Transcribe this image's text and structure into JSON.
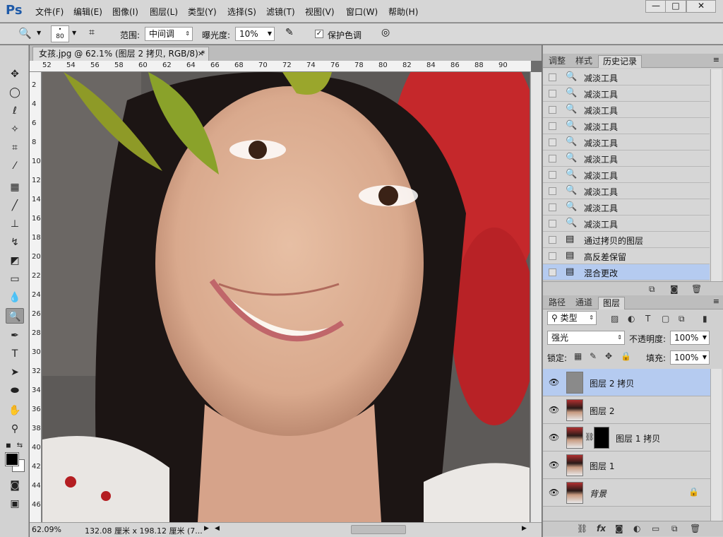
{
  "app": {
    "logo": "Ps"
  },
  "menu": [
    "文件(F)",
    "编辑(E)",
    "图像(I)",
    "图层(L)",
    "类型(Y)",
    "选择(S)",
    "滤镜(T)",
    "视图(V)",
    "窗口(W)",
    "帮助(H)"
  ],
  "window_controls": {
    "minimize": "—",
    "maximize": "□",
    "close": "✕"
  },
  "options": {
    "brush_size": "80",
    "range_label": "范围:",
    "range_value": "中间调",
    "exposure_label": "曝光度:",
    "exposure_value": "10%",
    "protect_tones_label": "保护色调",
    "protect_tones_checked": true
  },
  "document": {
    "tab_title": "女孩.jpg @ 62.1% (图层 2 拷贝, RGB/8) *",
    "close": "×",
    "ruler_h": [
      "52",
      "54",
      "56",
      "58",
      "60",
      "62",
      "64",
      "66",
      "68",
      "70",
      "72",
      "74",
      "76",
      "78",
      "80",
      "82",
      "84",
      "86",
      "88",
      "90"
    ],
    "ruler_v": [
      "2",
      "4",
      "6",
      "8",
      "10",
      "12",
      "14",
      "16",
      "18",
      "20",
      "22",
      "24",
      "26",
      "28",
      "30",
      "32",
      "34",
      "36",
      "38",
      "40",
      "42",
      "44",
      "46"
    ],
    "zoom": "62.09%",
    "doc_size": "132.08 厘米 x 198.12 厘米 (7..."
  },
  "history_panel": {
    "tabs": [
      "调整",
      "样式",
      "历史记录"
    ],
    "active_tab": "历史记录",
    "items": [
      {
        "label": "减淡工具",
        "icon": "dodge-icon"
      },
      {
        "label": "减淡工具",
        "icon": "dodge-icon"
      },
      {
        "label": "减淡工具",
        "icon": "dodge-icon"
      },
      {
        "label": "减淡工具",
        "icon": "dodge-icon"
      },
      {
        "label": "减淡工具",
        "icon": "dodge-icon"
      },
      {
        "label": "减淡工具",
        "icon": "dodge-icon"
      },
      {
        "label": "减淡工具",
        "icon": "dodge-icon"
      },
      {
        "label": "减淡工具",
        "icon": "dodge-icon"
      },
      {
        "label": "减淡工具",
        "icon": "dodge-icon"
      },
      {
        "label": "减淡工具",
        "icon": "dodge-icon"
      },
      {
        "label": "通过拷贝的图层",
        "icon": "document-icon"
      },
      {
        "label": "高反差保留",
        "icon": "document-icon"
      },
      {
        "label": "混合更改",
        "icon": "document-icon"
      }
    ],
    "selected_index": 12
  },
  "layers_panel": {
    "tabs": [
      "路径",
      "通道",
      "图层"
    ],
    "active_tab": "图层",
    "filter_label": "类型",
    "blend_mode": "强光",
    "opacity_label": "不透明度:",
    "opacity_value": "100%",
    "lock_label": "锁定:",
    "fill_label": "填充:",
    "fill_value": "100%",
    "layers": [
      {
        "name": "图层 2 拷贝",
        "selected": true
      },
      {
        "name": "图层 2",
        "selected": false
      },
      {
        "name": "图层 1 拷贝",
        "selected": false
      },
      {
        "name": "图层 1",
        "selected": false
      },
      {
        "name": "背景",
        "selected": false,
        "locked": true
      }
    ]
  }
}
